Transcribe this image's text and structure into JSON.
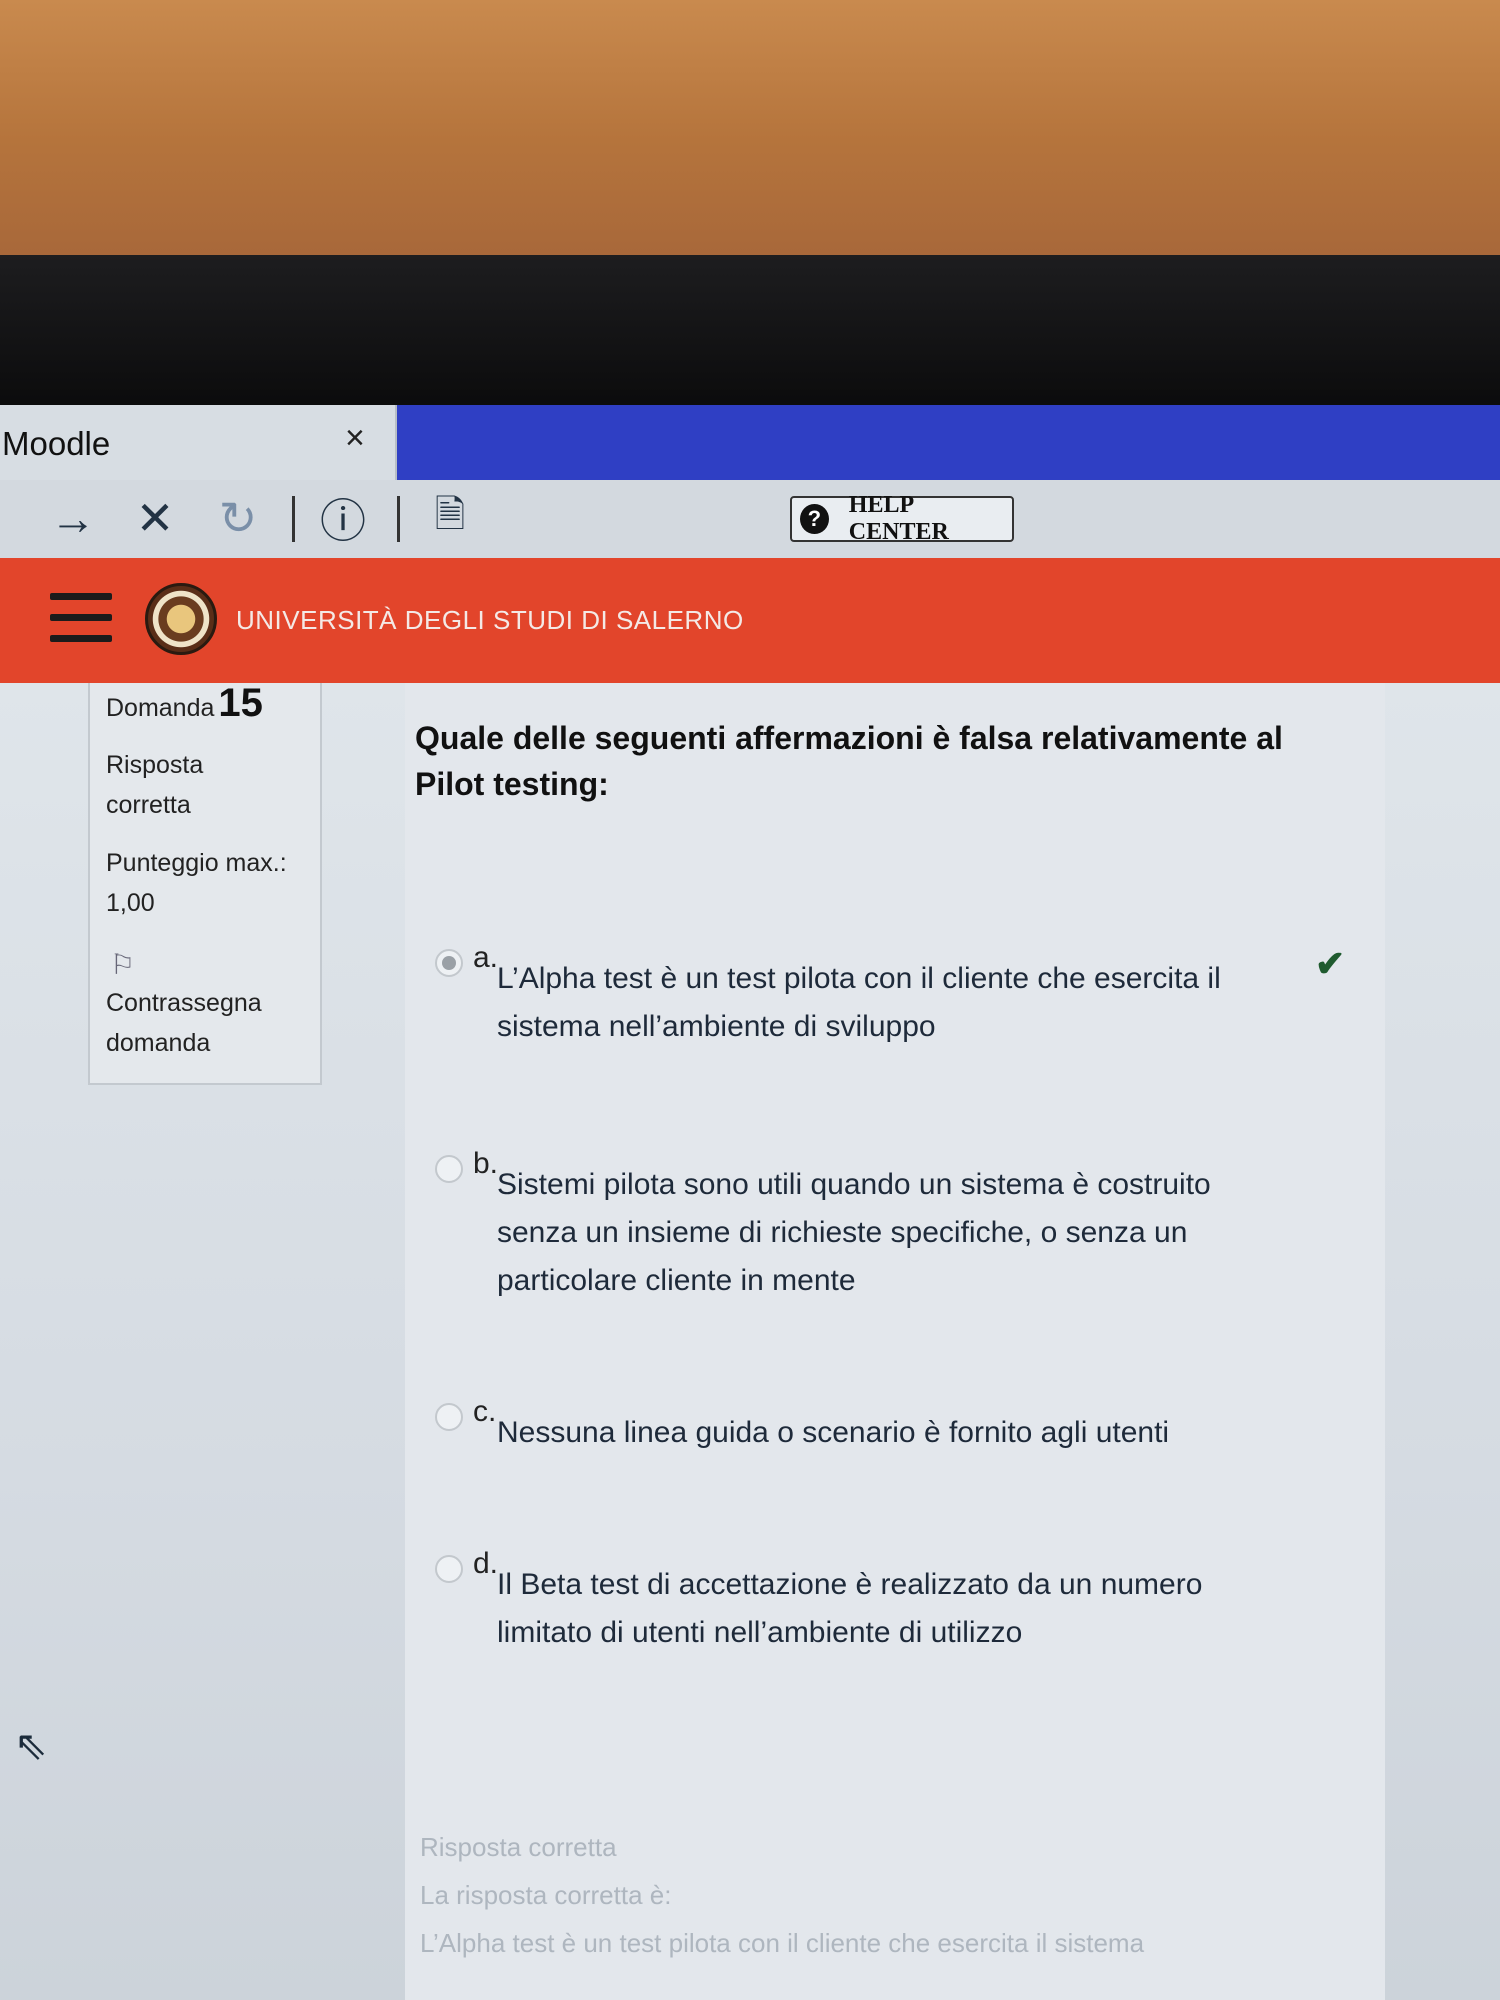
{
  "browser": {
    "tab_title": "Moodle",
    "tab_close": "×",
    "toolbar": {
      "forward": "→",
      "stop": "✕",
      "reload": "↻",
      "info": "ⓘ",
      "new_doc": "🗎"
    },
    "help_center": "HELP CENTER",
    "help_icon": "?"
  },
  "header": {
    "university": "UNIVERSITÀ DEGLI STUDI DI SALERNO"
  },
  "info": {
    "question_label": "Domanda",
    "question_number": "15",
    "status_line1": "Risposta",
    "status_line2": "corretta",
    "score_label": "Punteggio max.:",
    "score_value": "1,00",
    "flag_line1": "Contrassegna",
    "flag_line2": "domanda"
  },
  "question": {
    "text": "Quale delle seguenti affermazioni è falsa relativamente al Pilot testing:",
    "options": [
      {
        "letter": "a.",
        "text": "L’Alpha test è un test pilota con il cliente che esercita il sistema nell’ambiente di sviluppo",
        "selected": true,
        "correct": true
      },
      {
        "letter": "b.",
        "text": "Sistemi pilota sono utili quando un sistema è costruito senza un insieme di richieste specifiche, o senza un particolare cliente in mente",
        "selected": false
      },
      {
        "letter": "c.",
        "text": "Nessuna linea guida o scenario è fornito agli utenti",
        "selected": false
      },
      {
        "letter": "d.",
        "text": "Il Beta test di accettazione è realizzato da un numero limitato di utenti nell’ambiente di utilizzo",
        "selected": false
      }
    ]
  },
  "feedback": {
    "line1": "Risposta corretta",
    "line2": "La risposta corretta è:",
    "line3": "L’Alpha test è un test pilota con il cliente che esercita il sistema"
  },
  "colors": {
    "header_red": "#e2452b",
    "tab_blue": "#2f3fc4",
    "check_green": "#1f5b2f"
  }
}
